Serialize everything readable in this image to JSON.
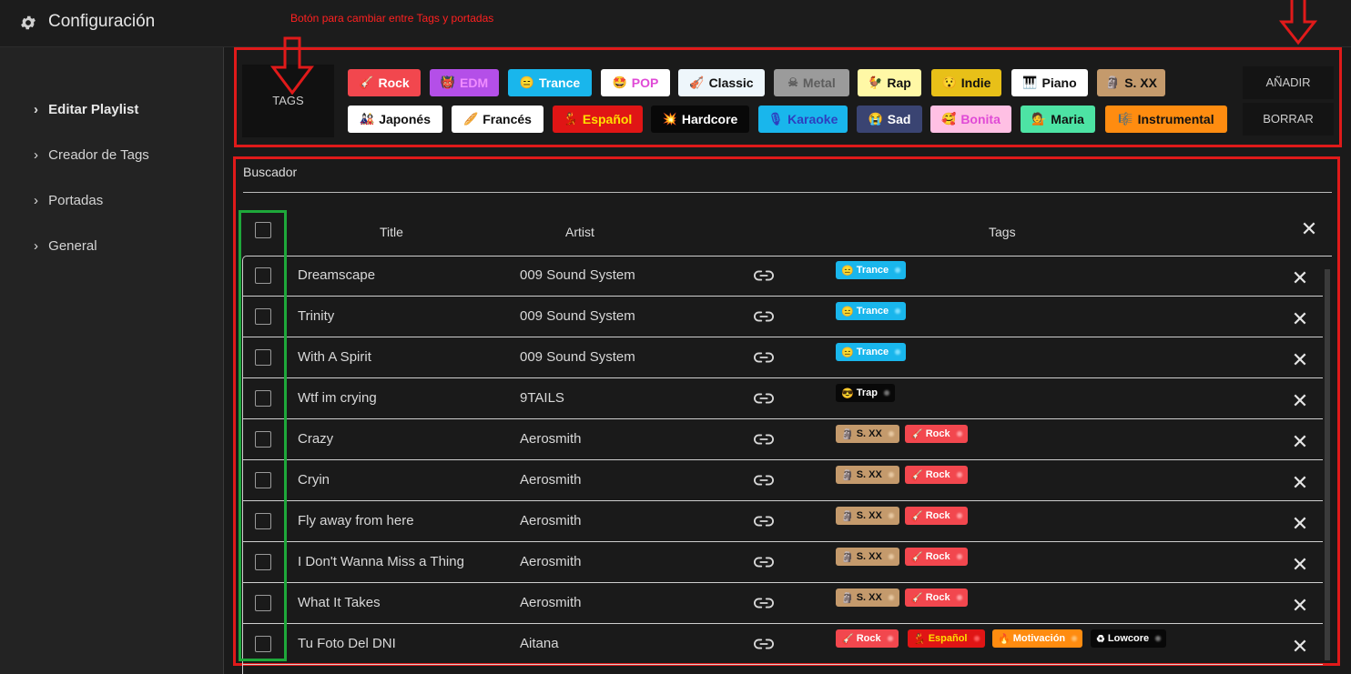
{
  "app": {
    "title": "Configuración"
  },
  "annotation": "Botón para cambiar entre Tags y portadas",
  "sidebar": {
    "items": [
      {
        "label": "Editar Playlist",
        "active": true
      },
      {
        "label": "Creador de Tags",
        "active": false
      },
      {
        "label": "Portadas",
        "active": false
      },
      {
        "label": "General",
        "active": false
      }
    ]
  },
  "tag_panel": {
    "toggle_label": "TAGS",
    "add_label": "AÑADIR",
    "delete_label": "BORRAR",
    "tags": [
      {
        "label": "Rock",
        "emoji": "🎸",
        "bg": "#f2474e",
        "fg": "#ffffff"
      },
      {
        "label": "EDM",
        "emoji": "👹",
        "bg": "#b44fe8",
        "fg": "#f08cff"
      },
      {
        "label": "Trance",
        "emoji": "😑",
        "bg": "#19b6ec",
        "fg": "#ffffff"
      },
      {
        "label": "POP",
        "emoji": "🤩",
        "bg": "#ffffff",
        "fg": "#e04ad6"
      },
      {
        "label": "Classic",
        "emoji": "🎻",
        "bg": "#eef6fb",
        "fg": "#111111"
      },
      {
        "label": "Metal",
        "emoji": "☠",
        "bg": "#9b9b9b",
        "fg": "#5d5d5d"
      },
      {
        "label": "Rap",
        "emoji": "🐓",
        "bg": "#fff8a6",
        "fg": "#111111"
      },
      {
        "label": "Indie",
        "emoji": "😯",
        "bg": "#e8c018",
        "fg": "#111111"
      },
      {
        "label": "Piano",
        "emoji": "🎹",
        "bg": "#ffffff",
        "fg": "#111111"
      },
      {
        "label": "S. XX",
        "emoji": "🗿",
        "bg": "#c49a6c",
        "fg": "#111111"
      },
      {
        "label": "Japonés",
        "emoji": "🎎",
        "bg": "#ffffff",
        "fg": "#111111"
      },
      {
        "label": "Francés",
        "emoji": "🥖",
        "bg": "#ffffff",
        "fg": "#111111"
      },
      {
        "label": "Español",
        "emoji": "💃",
        "bg": "#e01515",
        "fg": "#ffe000"
      },
      {
        "label": "Hardcore",
        "emoji": "💥",
        "bg": "#080808",
        "fg": "#ffffff"
      },
      {
        "label": "Karaoke",
        "emoji": "🎙",
        "bg": "#19b6ec",
        "fg": "#2d3fbf"
      },
      {
        "label": "Sad",
        "emoji": "😭",
        "bg": "#3a4472",
        "fg": "#ffffff"
      },
      {
        "label": "Bonita",
        "emoji": "🥰",
        "bg": "#ffc0e4",
        "fg": "#e04ad6"
      },
      {
        "label": "Maria",
        "emoji": "💁",
        "bg": "#4de3a4",
        "fg": "#111111"
      },
      {
        "label": "Instrumental",
        "emoji": "🎼",
        "bg": "#ff8c10",
        "fg": "#111111"
      }
    ]
  },
  "buscador": {
    "label": "Buscador",
    "columns": {
      "title": "Title",
      "artist": "Artist",
      "tags": "Tags"
    },
    "rows": [
      {
        "title": "Dreamscape",
        "artist": "009 Sound System",
        "tags": [
          {
            "label": "Trance",
            "emoji": "😑",
            "bg": "#19b6ec",
            "fg": "#ffffff",
            "dot": "#7fe0ff"
          }
        ]
      },
      {
        "title": "Trinity",
        "artist": "009 Sound System",
        "tags": [
          {
            "label": "Trance",
            "emoji": "😑",
            "bg": "#19b6ec",
            "fg": "#ffffff",
            "dot": "#7fe0ff"
          }
        ]
      },
      {
        "title": "With A Spirit",
        "artist": "009 Sound System",
        "tags": [
          {
            "label": "Trance",
            "emoji": "😑",
            "bg": "#19b6ec",
            "fg": "#ffffff",
            "dot": "#7fe0ff"
          }
        ]
      },
      {
        "title": "Wtf im crying",
        "artist": "9TAILS",
        "tags": [
          {
            "label": "Trap",
            "emoji": "😎",
            "bg": "#080808",
            "fg": "#ffffff",
            "dot": "#777777"
          }
        ]
      },
      {
        "title": "Crazy",
        "artist": "Aerosmith",
        "tags": [
          {
            "label": "S. XX",
            "emoji": "🗿",
            "bg": "#c49a6c",
            "fg": "#111111",
            "dot": "#e8c9a3"
          },
          {
            "label": "Rock",
            "emoji": "🎸",
            "bg": "#f2474e",
            "fg": "#ffffff",
            "dot": "#ffa0a4"
          }
        ]
      },
      {
        "title": "Cryin",
        "artist": "Aerosmith",
        "tags": [
          {
            "label": "S. XX",
            "emoji": "🗿",
            "bg": "#c49a6c",
            "fg": "#111111",
            "dot": "#e8c9a3"
          },
          {
            "label": "Rock",
            "emoji": "🎸",
            "bg": "#f2474e",
            "fg": "#ffffff",
            "dot": "#ffa0a4"
          }
        ]
      },
      {
        "title": "Fly away from here",
        "artist": "Aerosmith",
        "tags": [
          {
            "label": "S. XX",
            "emoji": "🗿",
            "bg": "#c49a6c",
            "fg": "#111111",
            "dot": "#e8c9a3"
          },
          {
            "label": "Rock",
            "emoji": "🎸",
            "bg": "#f2474e",
            "fg": "#ffffff",
            "dot": "#ffa0a4"
          }
        ]
      },
      {
        "title": "I Don't Wanna Miss a Thing",
        "artist": "Aerosmith",
        "tags": [
          {
            "label": "S. XX",
            "emoji": "🗿",
            "bg": "#c49a6c",
            "fg": "#111111",
            "dot": "#e8c9a3"
          },
          {
            "label": "Rock",
            "emoji": "🎸",
            "bg": "#f2474e",
            "fg": "#ffffff",
            "dot": "#ffa0a4"
          }
        ]
      },
      {
        "title": "What It Takes",
        "artist": "Aerosmith",
        "tags": [
          {
            "label": "S. XX",
            "emoji": "🗿",
            "bg": "#c49a6c",
            "fg": "#111111",
            "dot": "#e8c9a3"
          },
          {
            "label": "Rock",
            "emoji": "🎸",
            "bg": "#f2474e",
            "fg": "#ffffff",
            "dot": "#ffa0a4"
          }
        ]
      },
      {
        "title": "Tu Foto Del DNI",
        "artist": "Aitana",
        "tags": [
          {
            "label": "Rock",
            "emoji": "🎸",
            "bg": "#f2474e",
            "fg": "#ffffff",
            "dot": "#ffa0a4"
          },
          {
            "label": "Español",
            "emoji": "💃",
            "bg": "#e01515",
            "fg": "#ffe000",
            "dot": "#ff6060"
          },
          {
            "label": "Motivación",
            "emoji": "🔥",
            "bg": "#ff8c10",
            "fg": "#ffffff",
            "dot": "#ffc070"
          },
          {
            "label": "Lowcore",
            "emoji": "♻",
            "bg": "#080808",
            "fg": "#ffffff",
            "dot": "#777777"
          }
        ]
      }
    ]
  },
  "colors": {
    "highlight_red": "#e01a1a",
    "highlight_green": "#1ea83a",
    "background": "#1a1a1a",
    "sidebar": "#232323"
  }
}
